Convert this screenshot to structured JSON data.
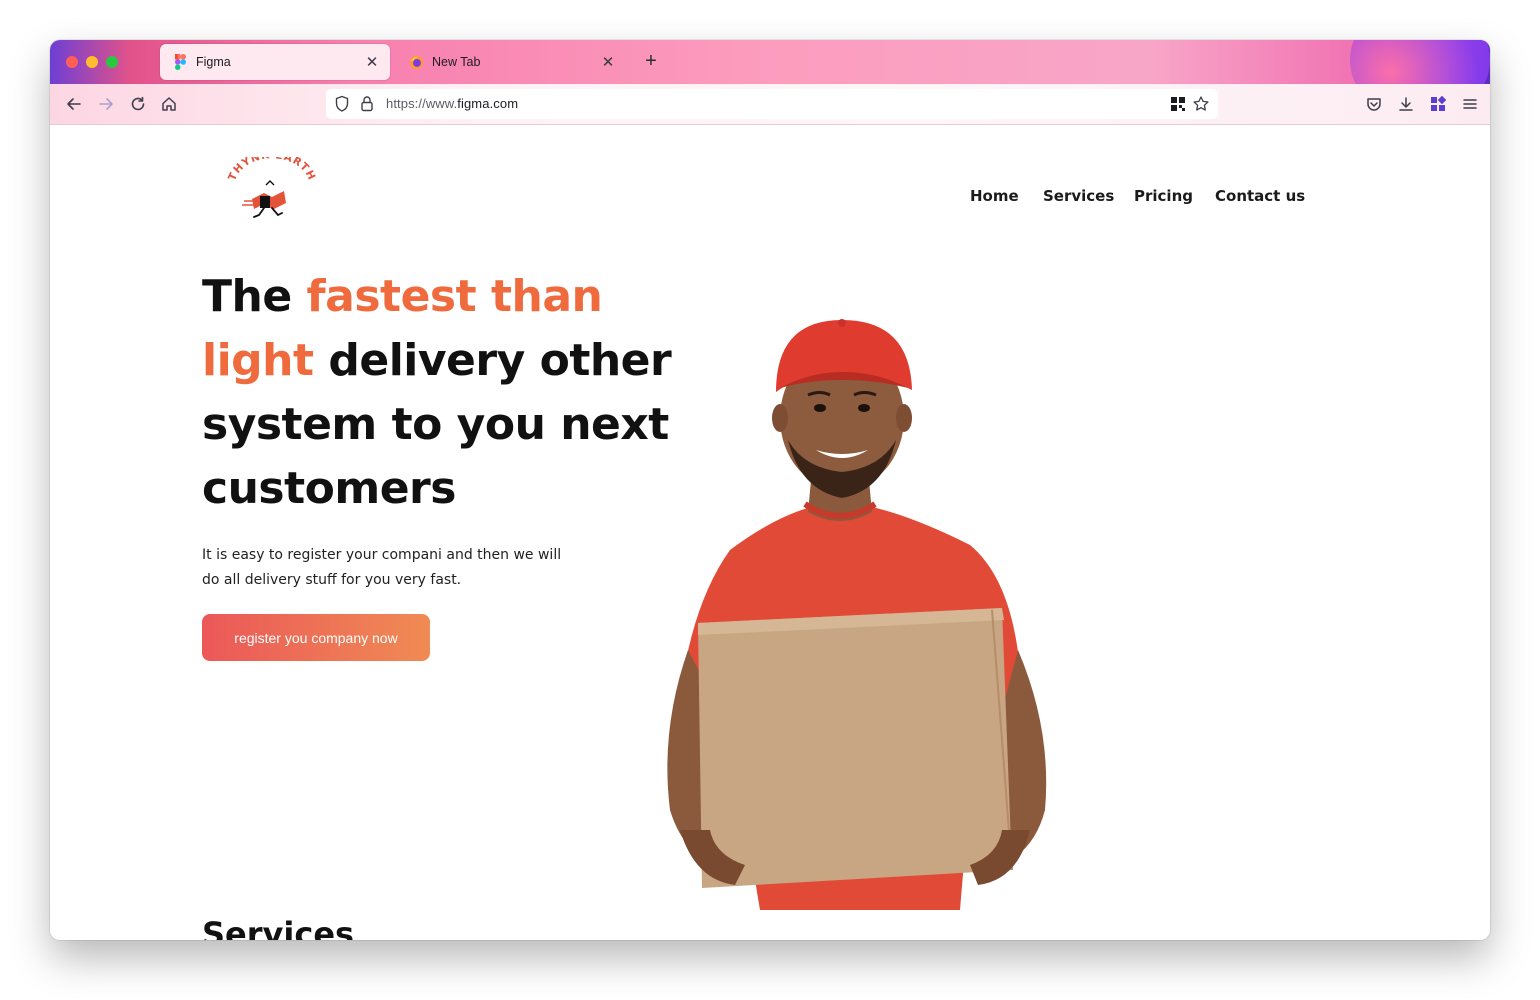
{
  "browser": {
    "tabs": [
      {
        "label": "Figma",
        "icon": "figma-icon",
        "active": true
      },
      {
        "label": "New Tab",
        "icon": "firefox-icon",
        "active": false
      }
    ],
    "new_tab_label": "+",
    "url_prefix": "https://www.",
    "url_domain": "figma.com"
  },
  "site": {
    "logo_text": "THYNK EARTH",
    "nav": [
      "Home",
      "Services",
      "Pricing",
      "Contact us"
    ],
    "hero": {
      "title_word_1": "The",
      "title_accent_1": "fastest",
      "title_accent_2": "than light",
      "title_rest": "delivery other system to you next customers",
      "subtitle": "It is easy to register your compani and then we will do all delivery stuff for you very fast.",
      "cta_label": "register you company now"
    },
    "services_heading": "Services"
  },
  "colors": {
    "accent": "#ef6b3d",
    "cta_start": "#eb5858",
    "cta_end": "#f08b54",
    "shirt_red": "#e24a38",
    "box": "#c9a683"
  }
}
